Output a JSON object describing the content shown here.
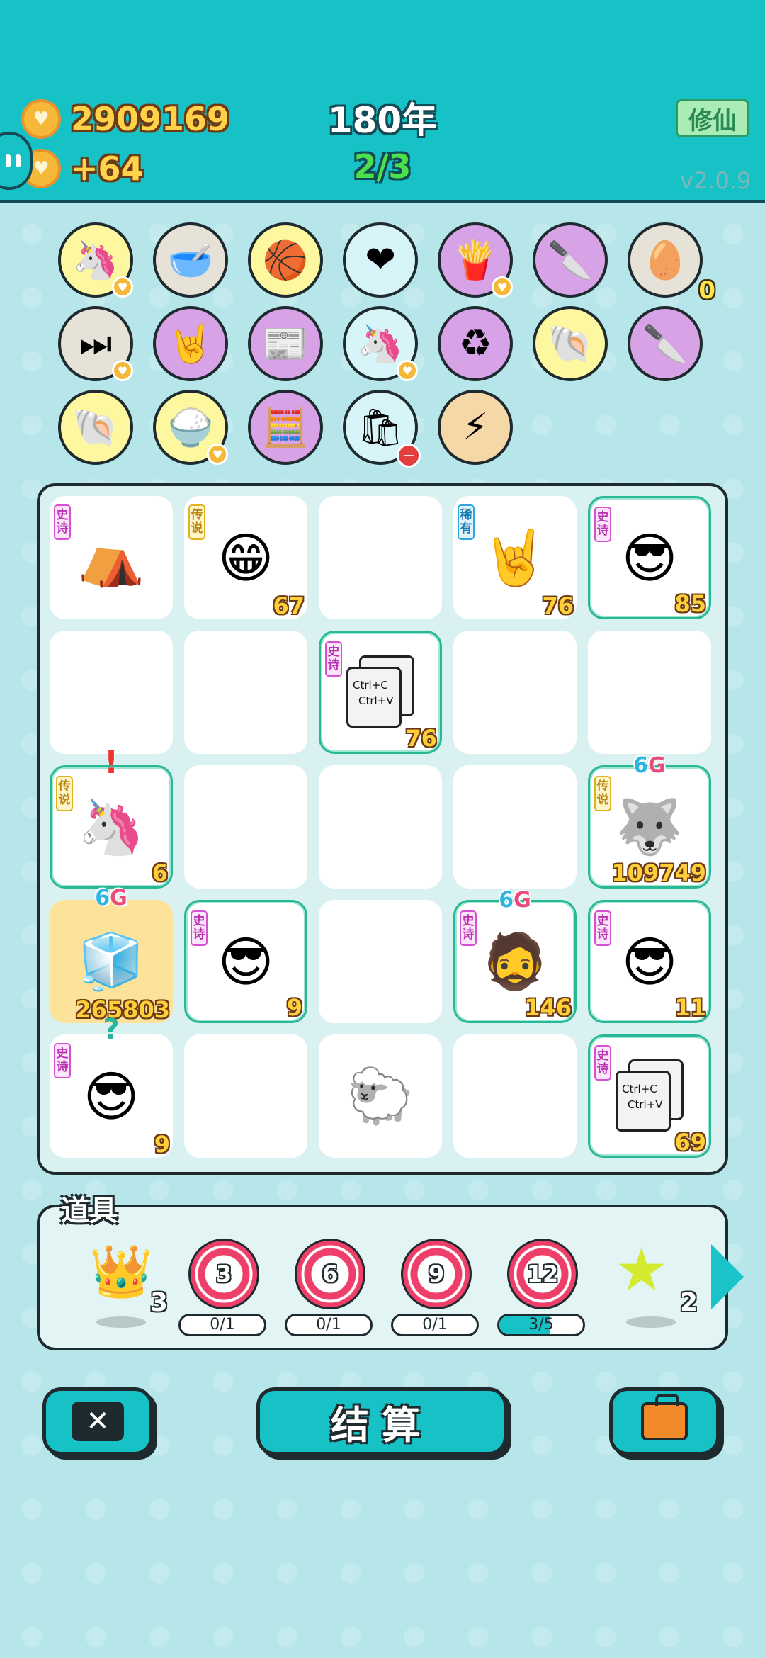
{
  "header": {
    "coins": "2909169",
    "income": "+64",
    "year": "180年",
    "round": "2/3",
    "xiuxian_label": "修仙",
    "version": "v2.0.9"
  },
  "items": [
    {
      "name": "unicorn-item",
      "emoji": "🦄",
      "bg": "#fdf7a0",
      "badge": "heart"
    },
    {
      "name": "dog-bowl-item",
      "emoji": "🥣",
      "bg": "#e6e2d8"
    },
    {
      "name": "basketballs-item",
      "emoji": "🏀",
      "bg": "#fdf7a0"
    },
    {
      "name": "heart-fan-item",
      "emoji": "❤",
      "bg": "#d7f5f8"
    },
    {
      "name": "fries-item",
      "emoji": "🍟",
      "bg": "#d7a3e6",
      "badge": "heart"
    },
    {
      "name": "cleaver-item",
      "emoji": "🔪",
      "bg": "#d7a3e6"
    },
    {
      "name": "egg-tray-item",
      "emoji": "🥚",
      "bg": "#e6e2d8",
      "count": "0"
    },
    {
      "name": "skip-item",
      "emoji": "⏭",
      "bg": "#e6e2d8",
      "badge": "heart"
    },
    {
      "name": "rock-hand-item",
      "emoji": "🤘",
      "bg": "#d7a3e6"
    },
    {
      "name": "time-magazine-item",
      "emoji": "📰",
      "bg": "#d7a3e6"
    },
    {
      "name": "twin-unicorns-item",
      "emoji": "🦄",
      "bg": "#d7f5f8",
      "badge": "heart"
    },
    {
      "name": "recycle-item",
      "emoji": "♻",
      "bg": "#d7a3e6"
    },
    {
      "name": "shell-item",
      "emoji": "🐚",
      "bg": "#fdf7a0"
    },
    {
      "name": "cleaver-item-2",
      "emoji": "🔪",
      "bg": "#d7a3e6"
    },
    {
      "name": "shell-item-2",
      "emoji": "🐚",
      "bg": "#fdf7a0"
    },
    {
      "name": "rice-bowl-item",
      "emoji": "🍚",
      "bg": "#fdf7a0",
      "badge": "heart"
    },
    {
      "name": "math-head-item",
      "emoji": "🧮",
      "bg": "#d7a3e6"
    },
    {
      "name": "trash-bag-item",
      "emoji": "🛍",
      "bg": "#d7f5f8",
      "badge": "minus"
    },
    {
      "name": "lightning-item",
      "emoji": "⚡",
      "bg": "#f6d7a8"
    }
  ],
  "board": [
    {
      "name": "tent-symbol",
      "tag": "史诗",
      "tagtype": "epic",
      "emoji": "⛺",
      "num": "",
      "style": ""
    },
    {
      "name": "bald-glasses-symbol",
      "tag": "传说",
      "tagtype": "legend",
      "emoji": "😁",
      "num": "67",
      "style": ""
    },
    {
      "name": "empty-cell",
      "tag": "",
      "emoji": "",
      "num": "",
      "style": ""
    },
    {
      "name": "rock-hand-symbol",
      "tag": "稀有",
      "tagtype": "rare",
      "emoji": "🤘",
      "num": "76",
      "style": ""
    },
    {
      "name": "green-hat-symbol",
      "tag": "史诗",
      "tagtype": "epic",
      "emoji": "😎",
      "num": "85",
      "style": "epic"
    },
    {
      "name": "empty-cell",
      "tag": "",
      "emoji": "",
      "num": "",
      "style": ""
    },
    {
      "name": "empty-cell",
      "tag": "",
      "emoji": "",
      "num": "",
      "style": ""
    },
    {
      "name": "copy-paste-symbol",
      "tag": "史诗",
      "tagtype": "epic",
      "emoji": "",
      "copy": true,
      "num": "76",
      "style": "epic"
    },
    {
      "name": "empty-cell",
      "tag": "",
      "emoji": "",
      "num": "",
      "style": ""
    },
    {
      "name": "empty-cell",
      "tag": "",
      "emoji": "",
      "num": "",
      "style": ""
    },
    {
      "name": "unicorn-symbol",
      "tag": "传说",
      "tagtype": "legend",
      "emoji": "🦄",
      "num": "6",
      "style": "epic",
      "over": "!"
    },
    {
      "name": "empty-cell",
      "tag": "",
      "emoji": "",
      "num": "",
      "style": ""
    },
    {
      "name": "empty-cell",
      "tag": "",
      "emoji": "",
      "num": "",
      "style": ""
    },
    {
      "name": "empty-cell",
      "tag": "",
      "emoji": "",
      "num": "",
      "style": ""
    },
    {
      "name": "husky-king-symbol",
      "tag": "传说",
      "tagtype": "legend",
      "emoji": "🐺",
      "num": "109749",
      "style": "epic",
      "over": "6G"
    },
    {
      "name": "fridge-symbol",
      "tag": "",
      "emoji": "🧊",
      "num": "265803",
      "style": "gold",
      "over": "6G"
    },
    {
      "name": "green-hat-symbol",
      "tag": "史诗",
      "tagtype": "epic",
      "emoji": "😎",
      "num": "9",
      "style": "epic"
    },
    {
      "name": "empty-cell",
      "tag": "",
      "emoji": "",
      "num": "",
      "style": ""
    },
    {
      "name": "bearded-man-symbol",
      "tag": "史诗",
      "tagtype": "epic",
      "emoji": "🧔",
      "num": "146",
      "style": "epic",
      "over": "6G"
    },
    {
      "name": "green-hat-symbol",
      "tag": "史诗",
      "tagtype": "epic",
      "emoji": "😎",
      "num": "11",
      "style": "epic"
    },
    {
      "name": "green-hat-symbol",
      "tag": "史诗",
      "tagtype": "epic",
      "emoji": "😎",
      "num": "9",
      "style": "",
      "over": "?"
    },
    {
      "name": "empty-cell",
      "tag": "",
      "emoji": "",
      "num": "",
      "style": ""
    },
    {
      "name": "sheep-symbol",
      "tag": "",
      "emoji": "🐑",
      "num": "",
      "style": ""
    },
    {
      "name": "empty-cell",
      "tag": "",
      "emoji": "",
      "num": "",
      "style": ""
    },
    {
      "name": "copy-paste-symbol",
      "tag": "史诗",
      "tagtype": "epic",
      "emoji": "",
      "copy": true,
      "num": "69",
      "style": "epic"
    }
  ],
  "copy_text": {
    "line1": "Ctrl+C",
    "line2": "Ctrl+V"
  },
  "tools": {
    "title": "道具",
    "crown_count": "3",
    "star_count": "2",
    "targets": [
      {
        "value": "3",
        "progress": "0/1",
        "fill": 0
      },
      {
        "value": "6",
        "progress": "0/1",
        "fill": 0
      },
      {
        "value": "9",
        "progress": "0/1",
        "fill": 0
      },
      {
        "value": "12",
        "progress": "3/5",
        "fill": 0.6
      }
    ]
  },
  "buttons": {
    "settle": "结算"
  }
}
